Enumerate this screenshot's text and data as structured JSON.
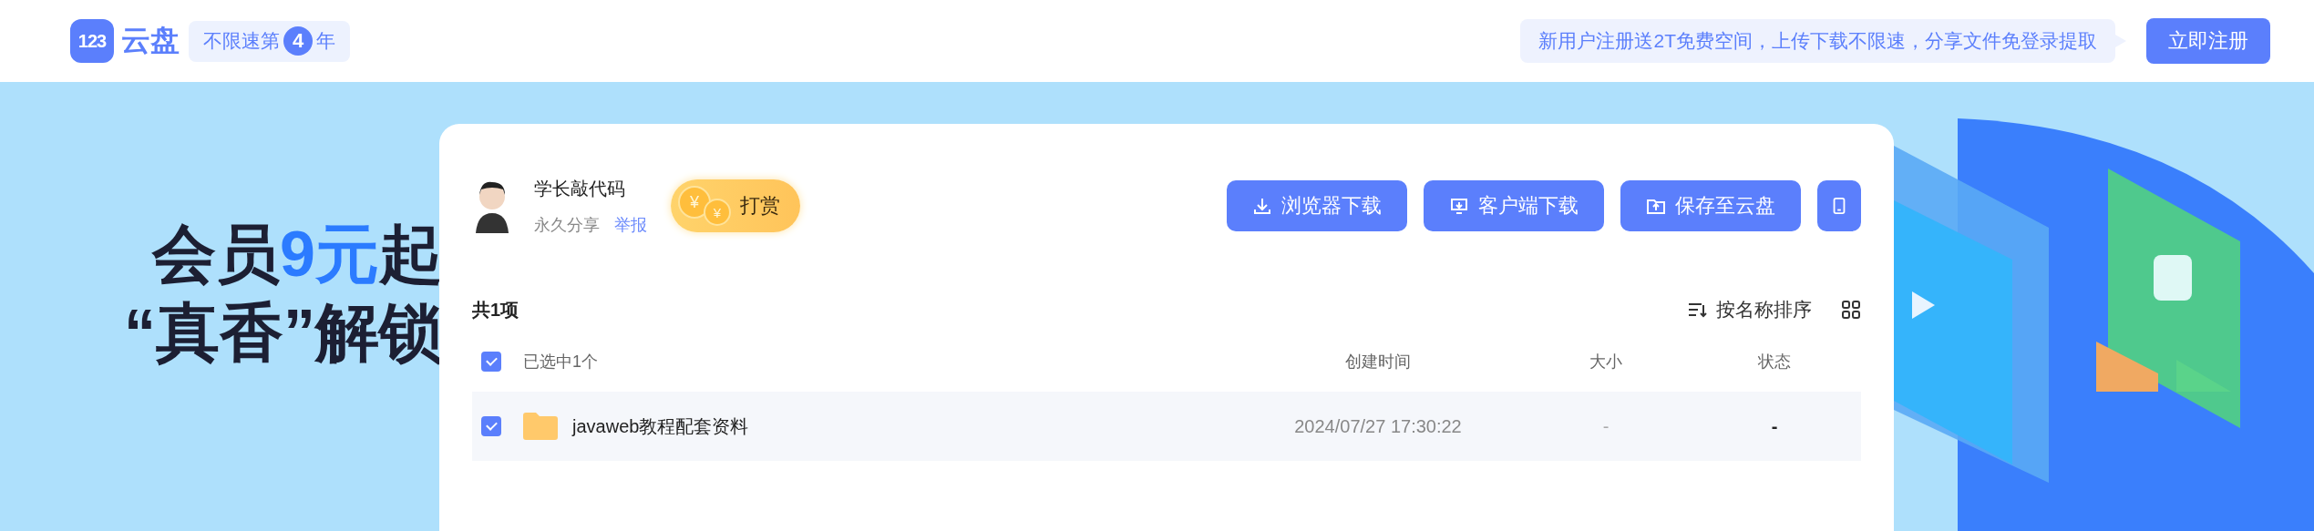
{
  "header": {
    "logo_number": "123",
    "logo_text": "云盘",
    "promo_badge": {
      "text_before": "不限速第",
      "number": "4",
      "text_after": "年"
    },
    "notice": "新用户注册送2T免费空间，上传下载不限速，分享文件免登录提取",
    "register_button": "立即注册"
  },
  "banner": {
    "line_1_start": "会员",
    "line_1_highlight": "9元",
    "line_1_end": "起",
    "line_2": "“真香”解锁"
  },
  "share": {
    "owner_name": "学长敲代码",
    "validity": "永久分享",
    "report_link": "举报",
    "tip_button": "打赏",
    "tip_coin_symbols": [
      "¥",
      "¥"
    ],
    "actions": [
      {
        "kind": "download",
        "label": "浏览器下载"
      },
      {
        "kind": "client",
        "label": "客户端下载"
      },
      {
        "kind": "save",
        "label": "保存至云盘"
      },
      {
        "kind": "mobile"
      }
    ]
  },
  "listing": {
    "total": "共1项",
    "sort_label": "按名称排序",
    "header": {
      "all_checked": true,
      "selection_label": "已选中1个",
      "columns": [
        "创建时间",
        "大小",
        "状态"
      ]
    },
    "rows": [
      {
        "checked": true,
        "name": "javaweb教程配套资料",
        "created": "2024/07/27 17:30:22",
        "size": "-",
        "status": "-"
      }
    ]
  }
}
